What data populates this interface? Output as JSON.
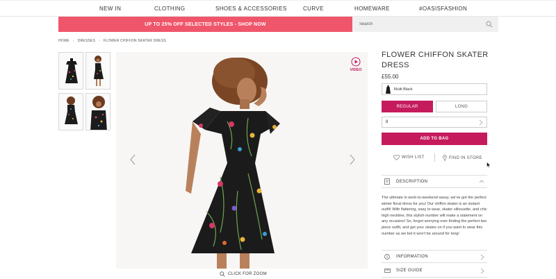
{
  "topnav": {
    "items": [
      "NEW IN",
      "CLOTHING",
      "SHOES & ACCESSORIES",
      "CURVE",
      "HOMEWARE",
      "#OASISFASHION"
    ]
  },
  "promo": {
    "text": "UP TO 25% OFF SELECTED STYLES - SHOP NOW"
  },
  "search": {
    "placeholder": "Search",
    "icon": "search-icon"
  },
  "breadcrumb": [
    "HOME",
    "DRESSES",
    "FLOWER CHIFFON SKATER DRESS"
  ],
  "gallery": {
    "video_label": "VIDEO",
    "zoom_label": "CLICK FOR ZOOM"
  },
  "product": {
    "title": "FLOWER CHIFFON SKATER DRESS",
    "price": "£55.00",
    "colour": "Multi Black",
    "fit_options": [
      "REGULAR",
      "LONG"
    ],
    "selected_fit": "REGULAR",
    "size": "8",
    "add_to_bag": "ADD TO BAG",
    "wishlist": "WISH LIST",
    "find_in_store": "FIND IN STORE"
  },
  "accordions": {
    "description": "DESCRIPTION",
    "description_text": "The ultimate in work-to-weekend sassy, we've got the perfect winter floral dress for you! Our chiffon skater is an instant outfit! With flattering, easy to wear, skater silhouette, and chic high neckline, this stylish number will make a statement on any occasion! So, forget worrying over finding the perfect two piece outfit, and get your skates on if you want to wear this number as we bet it won't be around for long!",
    "information": "INFORMATION",
    "size_guide": "SIZE GUIDE"
  },
  "colors": {
    "accent": "#c51b5d",
    "promo": "#f0566b"
  }
}
